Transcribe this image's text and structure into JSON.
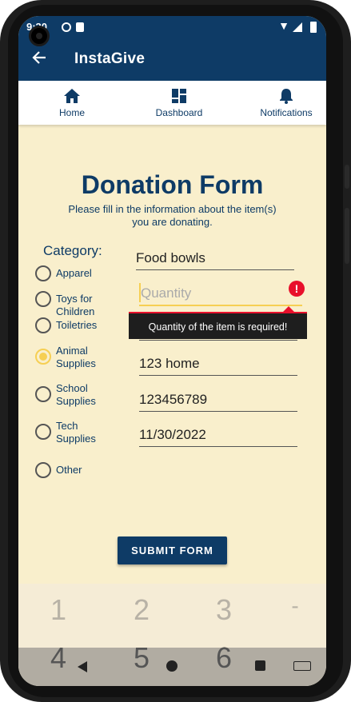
{
  "status_bar": {
    "time": "9:30"
  },
  "app": {
    "title": "InstaGive"
  },
  "tabs": [
    {
      "label": "Home",
      "icon": "home-icon"
    },
    {
      "label": "Dashboard",
      "icon": "dashboard-icon"
    },
    {
      "label": "Notifications",
      "icon": "bell-icon"
    }
  ],
  "form": {
    "title": "Donation Form",
    "subtitle": "Please fill in the information about the item(s) you are donating.",
    "category_label": "Category:",
    "categories": [
      {
        "label": "Apparel",
        "checked": false
      },
      {
        "label": "Toys for Children",
        "checked": false
      },
      {
        "label": "Toiletries",
        "checked": false
      },
      {
        "label": "Animal Supplies",
        "checked": true
      },
      {
        "label": "School Supplies",
        "checked": false
      },
      {
        "label": "Tech Supplies",
        "checked": false
      },
      {
        "label": "Other",
        "checked": false
      }
    ],
    "fields": {
      "item_name": "Food bowls",
      "quantity_placeholder": "Quantity",
      "address": "123 home",
      "phone": "123456789",
      "date": "11/30/2022"
    },
    "error_tooltip": "Quantity of the item is required!",
    "error_icon": "!",
    "submit_label": "SUBMIT FORM"
  },
  "keypad": {
    "row1": [
      "1",
      "2",
      "3",
      "-"
    ],
    "row2": [
      "4",
      "5",
      "6"
    ]
  },
  "colors": {
    "primary": "#0e3b66",
    "background": "#f9efcc",
    "accent": "#f6cf53",
    "error": "#e8102b"
  }
}
